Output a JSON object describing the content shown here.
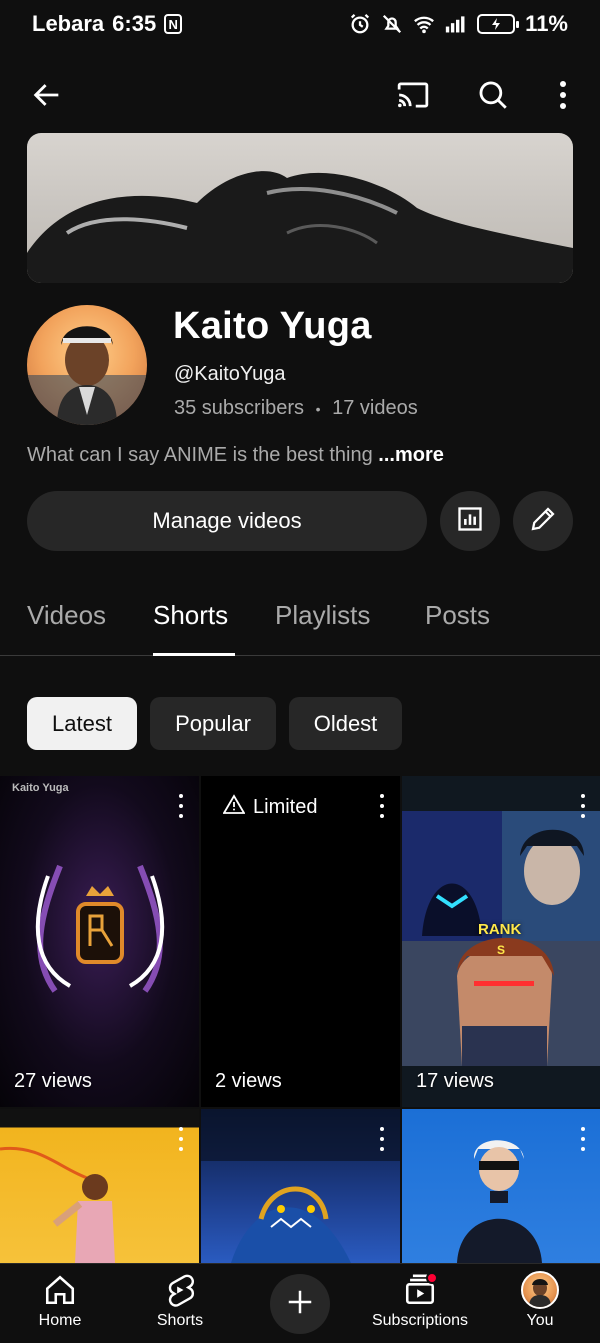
{
  "status_bar": {
    "carrier": "Lebara",
    "time": "6:35",
    "nfc_label": "N",
    "battery": "11%"
  },
  "top_bar": {
    "icons": [
      "back-arrow-icon",
      "cast-icon",
      "search-icon",
      "more-vert-icon"
    ]
  },
  "channel": {
    "name": "Kaito Yuga",
    "handle": "@KaitoYuga",
    "subscribers": "35 subscribers",
    "separator": "•",
    "videos": "17 videos",
    "description": "What can I say ANIME is the best thing ",
    "more_label": "...more"
  },
  "actions": {
    "manage_label": "Manage videos",
    "icons": [
      "analytics-icon",
      "edit-pencil-icon"
    ]
  },
  "tabs": [
    {
      "label": "Videos"
    },
    {
      "label": "Shorts",
      "active": true
    },
    {
      "label": "Playlists"
    },
    {
      "label": "Posts"
    }
  ],
  "filters": [
    {
      "label": "Latest",
      "active": true
    },
    {
      "label": "Popular"
    },
    {
      "label": "Oldest"
    }
  ],
  "shorts": [
    {
      "views": "27 views",
      "watermark": "Kaito Yuga"
    },
    {
      "views": "2 views",
      "badge": "Limited"
    },
    {
      "views": "17 views",
      "overlay_text": "RANK",
      "overlay_sub": "S"
    },
    {
      "views": ""
    },
    {
      "views": ""
    },
    {
      "views": ""
    }
  ],
  "bottom_nav": [
    {
      "label": "Home",
      "icon": "home-icon"
    },
    {
      "label": "Shorts",
      "icon": "shorts-icon"
    },
    {
      "label": "",
      "icon": "create-plus-icon"
    },
    {
      "label": "Subscriptions",
      "icon": "subscriptions-icon"
    },
    {
      "label": "You",
      "icon": "account-avatar"
    }
  ],
  "colors": {
    "background": "#0f0f0f",
    "surface": "#272727",
    "secondary_text": "#aaaaaa",
    "notification": "#ff0033"
  }
}
